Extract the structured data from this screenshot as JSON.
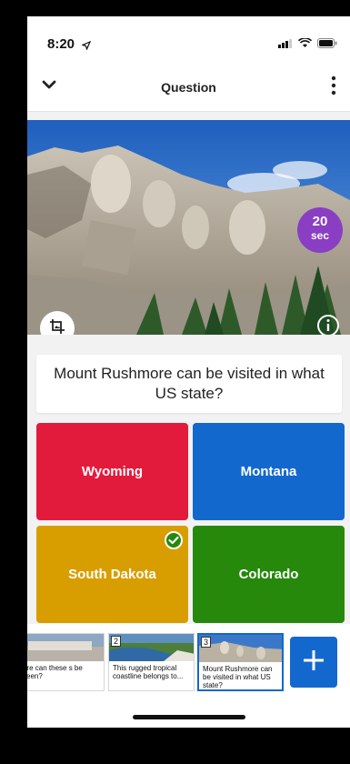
{
  "status": {
    "time": "8:20"
  },
  "nav": {
    "title": "Question"
  },
  "timer": {
    "value": "20",
    "unit": "sec"
  },
  "question": {
    "text": "Mount Rushmore can be visited in what US state?"
  },
  "answers": [
    {
      "label": "Wyoming",
      "color": "#e21b3c",
      "correct": false
    },
    {
      "label": "Montana",
      "color": "#1368ce",
      "correct": false
    },
    {
      "label": "South Dakota",
      "color": "#d89e00",
      "correct": true
    },
    {
      "label": "Colorado",
      "color": "#26890c",
      "correct": false
    }
  ],
  "slides": [
    {
      "number": "",
      "caption": "ere can these s be seen?"
    },
    {
      "number": "2",
      "caption": "This rugged tropical coastline belongs to..."
    },
    {
      "number": "3",
      "caption": "Mount Rushmore can be visited in what US state?"
    }
  ],
  "icons": {
    "back": "chevron-down-icon",
    "more": "more-vertical-icon",
    "crop": "crop-icon",
    "info": "info-icon",
    "check": "check-circle-icon",
    "add": "plus-icon"
  }
}
